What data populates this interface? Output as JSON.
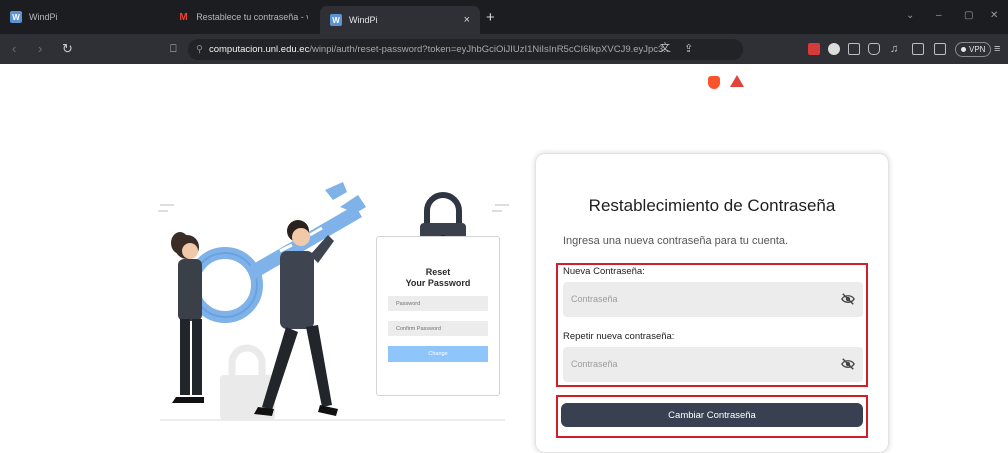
{
  "browser": {
    "tabs": [
      {
        "title": "WindPi",
        "icon": "windpi-favicon"
      },
      {
        "title": "Restablece tu contraseña - veronica.",
        "icon": "gmail-favicon"
      },
      {
        "title": "WindPi",
        "icon": "windpi-favicon",
        "active": true
      }
    ],
    "new_tab": "+",
    "close_tab": "×",
    "window_controls": [
      "⌄",
      "–",
      "▢",
      "✕"
    ],
    "url": {
      "host": "computacion.unl.edu.ec",
      "path": "/winpi/auth/reset-password?token=eyJhbGciOiJIUzI1NiIsInR5cCI6IkpXVCJ9.eyJpc3..."
    },
    "vpn_label": "VPN",
    "accent_color": "#fb542b"
  },
  "illustration": {
    "title_line1": "Reset",
    "title_line2": "Your Password",
    "field1": "Password",
    "field2": "Confirm Password",
    "button": "Change"
  },
  "form": {
    "title": "Restablecimiento de Contraseña",
    "subtitle": "Ingresa una nueva contraseña para tu cuenta.",
    "new_password_label": "Nueva Contraseña:",
    "new_password_placeholder": "Contraseña",
    "repeat_password_label": "Repetir nueva contraseña:",
    "repeat_password_placeholder": "Contraseña",
    "submit_label": "Cambiar Contraseña",
    "button_color": "#384052",
    "highlight_color": "#d01f26"
  }
}
